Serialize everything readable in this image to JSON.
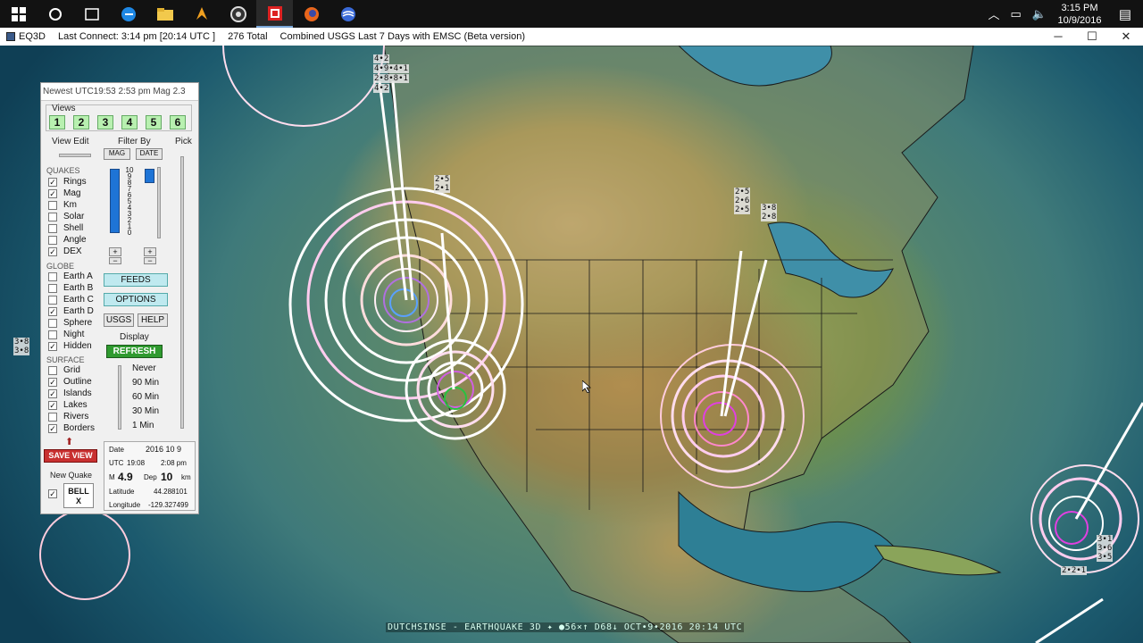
{
  "taskbar": {
    "icons": [
      "windows-start",
      "cortana",
      "task-view",
      "edge",
      "file-explorer",
      "winamp",
      "obs",
      "eq3d",
      "firefox",
      "earth"
    ],
    "clock_time": "3:15 PM",
    "clock_date": "10/9/2016",
    "notification_count": "1"
  },
  "titlebar": {
    "app_name": "EQ3D",
    "last_connect": "Last Connect: 3:14 pm  [20:14 UTC ]",
    "total": "276  Total",
    "source": "Combined USGS Last 7 Days with EMSC (Beta version)"
  },
  "panel": {
    "newest": "Newest UTC19:53  2:53 pm  Mag 2.3",
    "views_label": "Views",
    "views": [
      "1",
      "2",
      "3",
      "4",
      "5",
      "6"
    ],
    "view_edit": "View Edit",
    "filter_by": "Filter By",
    "pick": "Pick",
    "mag_btn": "MAG",
    "date_btn": "DATE",
    "quakes_label": "QUAKES",
    "quakes": [
      {
        "label": "Rings",
        "checked": true
      },
      {
        "label": "Mag",
        "checked": true
      },
      {
        "label": "Km",
        "checked": false
      },
      {
        "label": "Solar",
        "checked": false
      },
      {
        "label": "Shell",
        "checked": false
      },
      {
        "label": "Angle",
        "checked": false
      },
      {
        "label": "DEX",
        "checked": true
      }
    ],
    "globe_label": "GLOBE",
    "globe": [
      {
        "label": "Earth A",
        "checked": false
      },
      {
        "label": "Earth B",
        "checked": false
      },
      {
        "label": "Earth C",
        "checked": false
      },
      {
        "label": "Earth D",
        "checked": true
      },
      {
        "label": "Sphere",
        "checked": false
      },
      {
        "label": "Night",
        "checked": false
      },
      {
        "label": "Hidden",
        "checked": true
      }
    ],
    "surface_label": "SURFACE",
    "surface": [
      {
        "label": "Grid",
        "checked": false
      },
      {
        "label": "Outline",
        "checked": true
      },
      {
        "label": "Islands",
        "checked": true
      },
      {
        "label": "Lakes",
        "checked": true
      },
      {
        "label": "Rivers",
        "checked": false
      },
      {
        "label": "Borders",
        "checked": true
      }
    ],
    "scale": [
      "10",
      "9",
      "8",
      "7",
      "6",
      "5",
      "4",
      "3",
      "2",
      "1",
      "0"
    ],
    "plus": "+",
    "minus": "−",
    "feeds": "FEEDS",
    "options": "OPTIONS",
    "usgs": "USGS",
    "help": "HELP",
    "display": "Display",
    "refresh": "REFRESH",
    "refresh_opts": [
      "Never",
      "90 Min",
      "60 Min",
      "30 Min",
      "1 Min"
    ],
    "save_view": "SAVE VIEW",
    "new_quake": "New Quake",
    "bell": "BELL",
    "bell_x": "X",
    "info": {
      "date_label": "Date",
      "date_val": "2016  10  9",
      "utc_label": "UTC",
      "utc_val": "19:08",
      "local_time": "2:08 pm",
      "m_label": "M",
      "m_val": "4.9",
      "dep_label": "Dep",
      "dep_val": "10",
      "km": "km",
      "lat_label": "Latitude",
      "lat_val": "44.288101",
      "lon_label": "Longitude",
      "lon_val": "-129.327499"
    }
  },
  "map_labels": [
    {
      "id": "mag-nw-1",
      "text": "4•2"
    },
    {
      "id": "mag-nw-2",
      "text": "4•9•4•1"
    },
    {
      "id": "mag-nw-3",
      "text": "2•8•8•1"
    },
    {
      "id": "mag-nw-4",
      "text": "4•2"
    },
    {
      "id": "mag-or",
      "text": "2•5\n2•1"
    },
    {
      "id": "mag-midwest-1",
      "text": "2•5\n2•6\n2•5"
    },
    {
      "id": "mag-midwest-2",
      "text": "3•8\n2•8"
    },
    {
      "id": "mag-pacific",
      "text": "3•8\n3•8"
    },
    {
      "id": "mag-carib-1",
      "text": "3•1\n3•6\n3•5"
    },
    {
      "id": "mag-carib-2",
      "text": "2•2•1"
    }
  ],
  "status_bar": "DUTCHSINSE - EARTHQUAKE 3D  ✦  ●56×↑ D68↓ OCT•9•2016  20:14 UTC"
}
